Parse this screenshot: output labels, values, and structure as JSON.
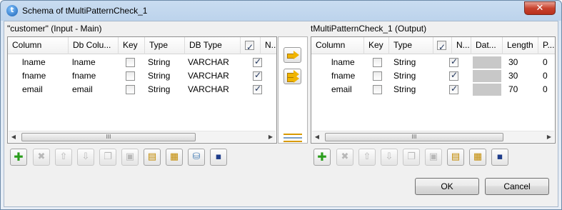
{
  "window": {
    "title": "Schema of tMultiPatternCheck_1",
    "close_label": "✕",
    "app_icon_glyph": "t"
  },
  "left": {
    "label": "\"customer\" (Input - Main)",
    "headers": [
      "Column",
      "Db Colu...",
      "Key",
      "Type",
      "DB Type",
      "",
      "N..."
    ],
    "rows": [
      {
        "column": "lname",
        "db_column": "lname",
        "key": false,
        "type": "String",
        "db_type": "VARCHAR",
        "nullable": true
      },
      {
        "column": "fname",
        "db_column": "fname",
        "key": false,
        "type": "String",
        "db_type": "VARCHAR",
        "nullable": true
      },
      {
        "column": "email",
        "db_column": "email",
        "key": false,
        "type": "String",
        "db_type": "VARCHAR",
        "nullable": true
      }
    ],
    "scroll_thumb_glyph": "III"
  },
  "right": {
    "label": "tMultiPatternCheck_1 (Output)",
    "headers": [
      "Column",
      "Key",
      "Type",
      "",
      "N...",
      "Dat...",
      "Length",
      "P..."
    ],
    "rows": [
      {
        "column": "lname",
        "key": false,
        "type": "String",
        "nullable": true,
        "length": "30",
        "precision": "0"
      },
      {
        "column": "fname",
        "key": false,
        "type": "String",
        "nullable": true,
        "length": "30",
        "precision": "0"
      },
      {
        "column": "email",
        "key": false,
        "type": "String",
        "nullable": true,
        "length": "70",
        "precision": "0"
      }
    ],
    "scroll_thumb_glyph": "III"
  },
  "toolbar_icons": [
    "add-icon",
    "remove-icon",
    "move-up-icon",
    "move-down-icon",
    "copy-icon",
    "paste-icon",
    "import-icon",
    "export-icon",
    "repository-icon",
    "save-icon"
  ],
  "buttons": {
    "ok": "OK",
    "cancel": "Cancel"
  }
}
